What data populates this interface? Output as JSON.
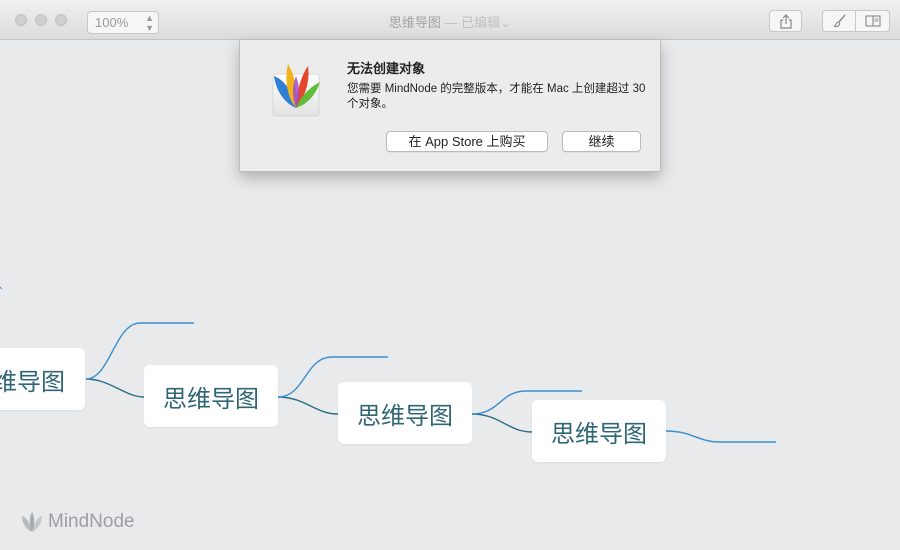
{
  "window": {
    "title": "思维导图",
    "title_separator": " — ",
    "status": "已编辑",
    "status_chevron": "⌄"
  },
  "toolbar": {
    "zoom_value": "100%",
    "zoom_arrows_icon": "up-down-arrows-icon",
    "share_icon": "share-icon",
    "style_icon": "brush-icon",
    "sidebar_icon": "sidebar-icon"
  },
  "alert": {
    "title": "无法创建对象",
    "message": "您需要 MindNode 的完整版本，才能在 Mac 上创建超过 30 个对象。",
    "buy_button": "在 App Store 上购买",
    "continue_button": "继续"
  },
  "mindmap": {
    "nodes": [
      {
        "label": "思维导图"
      },
      {
        "label": "思维导图"
      },
      {
        "label": "思维导图"
      },
      {
        "label": "思维导图"
      }
    ],
    "line_color": "#2c7a9c",
    "branch_color": "#3a8fd0"
  },
  "watermark": {
    "text": "MindNode"
  }
}
